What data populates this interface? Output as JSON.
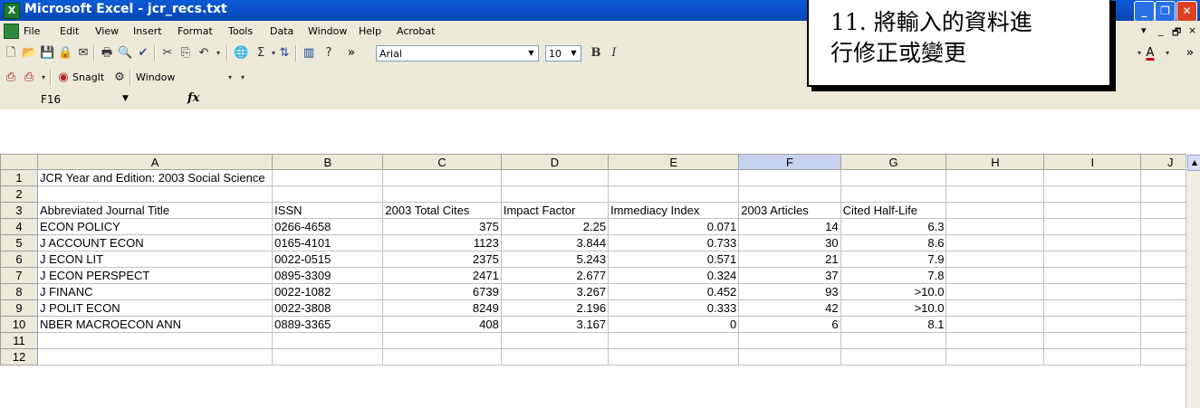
{
  "window": {
    "title": "Microsoft Excel - jcr_recs.txt",
    "app_icon_text": "X"
  },
  "menubar": {
    "items": [
      "File",
      "Edit",
      "View",
      "Insert",
      "Format",
      "Tools",
      "Data",
      "Window",
      "Help",
      "Acrobat"
    ]
  },
  "toolbar": {
    "font_name": "Arial",
    "font_size": "10",
    "bold": "B",
    "italic": "I",
    "more": "»",
    "font_color": "A"
  },
  "toolbar2": {
    "snagit_label": "SnagIt",
    "capture_mode": "Window"
  },
  "formula_bar": {
    "name_box": "F16",
    "fx": "fx",
    "formula": ""
  },
  "sheet": {
    "columns": [
      "A",
      "B",
      "C",
      "D",
      "E",
      "F",
      "G",
      "H",
      "I",
      "J"
    ],
    "selected_column": "F",
    "rows": [
      {
        "n": "1",
        "cells": [
          "JCR Year and Edition: 2003 Social Science",
          "",
          "",
          "",
          "",
          "",
          "",
          "",
          "",
          ""
        ]
      },
      {
        "n": "2",
        "cells": [
          "",
          "",
          "",
          "",
          "",
          "",
          "",
          "",
          "",
          ""
        ]
      },
      {
        "n": "3",
        "cells": [
          "Abbreviated Journal Title",
          "ISSN",
          "2003 Total Cites",
          "Impact Factor",
          "Immediacy Index",
          "2003 Articles",
          "Cited Half-Life",
          "",
          "",
          ""
        ]
      },
      {
        "n": "4",
        "cells": [
          "ECON POLICY",
          "0266-4658",
          "375",
          "2.25",
          "0.071",
          "14",
          "6.3",
          "",
          "",
          ""
        ]
      },
      {
        "n": "5",
        "cells": [
          "J ACCOUNT ECON",
          "0165-4101",
          "1123",
          "3.844",
          "0.733",
          "30",
          "8.6",
          "",
          "",
          ""
        ]
      },
      {
        "n": "6",
        "cells": [
          "J ECON LIT",
          "0022-0515",
          "2375",
          "5.243",
          "0.571",
          "21",
          "7.9",
          "",
          "",
          ""
        ]
      },
      {
        "n": "7",
        "cells": [
          "J ECON PERSPECT",
          "0895-3309",
          "2471",
          "2.677",
          "0.324",
          "37",
          "7.8",
          "",
          "",
          ""
        ]
      },
      {
        "n": "8",
        "cells": [
          "J FINANC",
          "0022-1082",
          "6739",
          "3.267",
          "0.452",
          "93",
          ">10.0",
          "",
          "",
          ""
        ]
      },
      {
        "n": "9",
        "cells": [
          "J POLIT ECON",
          "0022-3808",
          "8249",
          "2.196",
          "0.333",
          "42",
          ">10.0",
          "",
          "",
          ""
        ]
      },
      {
        "n": "10",
        "cells": [
          "NBER MACROECON ANN",
          "0889-3365",
          "408",
          "3.167",
          "0",
          "6",
          "8.1",
          "",
          "",
          ""
        ]
      },
      {
        "n": "11",
        "cells": [
          "",
          "",
          "",
          "",
          "",
          "",
          "",
          "",
          "",
          ""
        ]
      },
      {
        "n": "12",
        "cells": [
          "",
          "",
          "",
          "",
          "",
          "",
          "",
          "",
          "",
          ""
        ]
      }
    ]
  },
  "callout": {
    "line1": "11. 將輸入的資料進",
    "line2": "行修正或變更"
  }
}
